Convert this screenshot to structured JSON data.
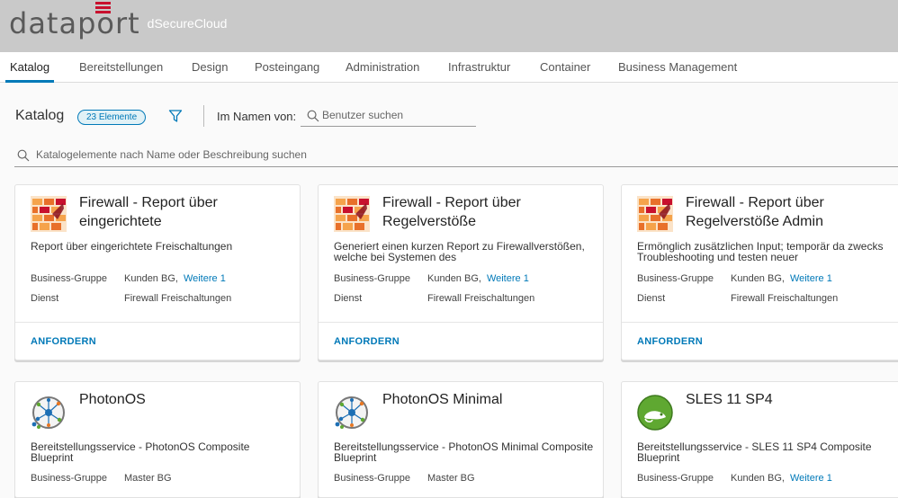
{
  "header": {
    "logo_text": "dataport",
    "product_name": "dSecureCloud",
    "brand_color": "#c8102e",
    "header_bg": "#c9c9c9"
  },
  "nav": {
    "tabs": [
      {
        "label": "Katalog",
        "active": true
      },
      {
        "label": "Bereitstellungen"
      },
      {
        "label": "Design"
      },
      {
        "label": "Posteingang"
      },
      {
        "label": "Administration"
      },
      {
        "label": "Infrastruktur"
      },
      {
        "label": "Container"
      },
      {
        "label": "Business Management"
      }
    ],
    "accent_color": "#0079b8"
  },
  "toolbar": {
    "title": "Katalog",
    "count_badge": "23 Elemente",
    "filter_icon": "filter-icon",
    "on_behalf_label": "Im Namen von:",
    "user_search_placeholder": "Benutzer suchen"
  },
  "search": {
    "placeholder": "Katalogelemente nach Name oder Beschreibung suchen"
  },
  "cards": [
    {
      "icon": "firewall-icon",
      "title": "Firewall - Report über eingerichtete",
      "description": "Report über eingerichtete Freischaltungen",
      "business_group_label": "Business-Gruppe",
      "business_group_value": "Kunden BG,",
      "business_group_more": "Weitere 1",
      "service_label": "Dienst",
      "service_value": "Firewall Freischaltungen",
      "action": "ANFORDERN"
    },
    {
      "icon": "firewall-icon",
      "title": "Firewall - Report über Regelverstöße",
      "description": "Generiert einen kurzen Report zu Firewallverstößen, welche bei Systemen des",
      "business_group_label": "Business-Gruppe",
      "business_group_value": "Kunden BG,",
      "business_group_more": "Weitere 1",
      "service_label": "Dienst",
      "service_value": "Firewall Freischaltungen",
      "action": "ANFORDERN"
    },
    {
      "icon": "firewall-icon",
      "title": "Firewall - Report über Regelverstöße Admin",
      "description": "Ermönglich zusätzlichen Input; temporär da zwecks Troubleshooting und testen neuer",
      "business_group_label": "Business-Gruppe",
      "business_group_value": "Kunden BG,",
      "business_group_more": "Weitere 1",
      "service_label": "Dienst",
      "service_value": "Firewall Freischaltungen",
      "action": "ANFORDERN"
    },
    {
      "icon": "photon-icon",
      "title": "PhotonOS",
      "description": "Bereitstellungsservice - PhotonOS Composite Blueprint",
      "business_group_label": "Business-Gruppe",
      "business_group_value": "Master BG"
    },
    {
      "icon": "photon-icon",
      "title": "PhotonOS Minimal",
      "description": "Bereitstellungsservice - PhotonOS Minimal Composite Blueprint",
      "business_group_label": "Business-Gruppe",
      "business_group_value": "Master BG"
    },
    {
      "icon": "suse-chameleon-icon",
      "title": "SLES 11 SP4",
      "description": "Bereitstellungsservice - SLES 11 SP4 Composite Blueprint",
      "business_group_label": "Business-Gruppe",
      "business_group_value": "Kunden BG,",
      "business_group_more": "Weitere 1"
    }
  ]
}
